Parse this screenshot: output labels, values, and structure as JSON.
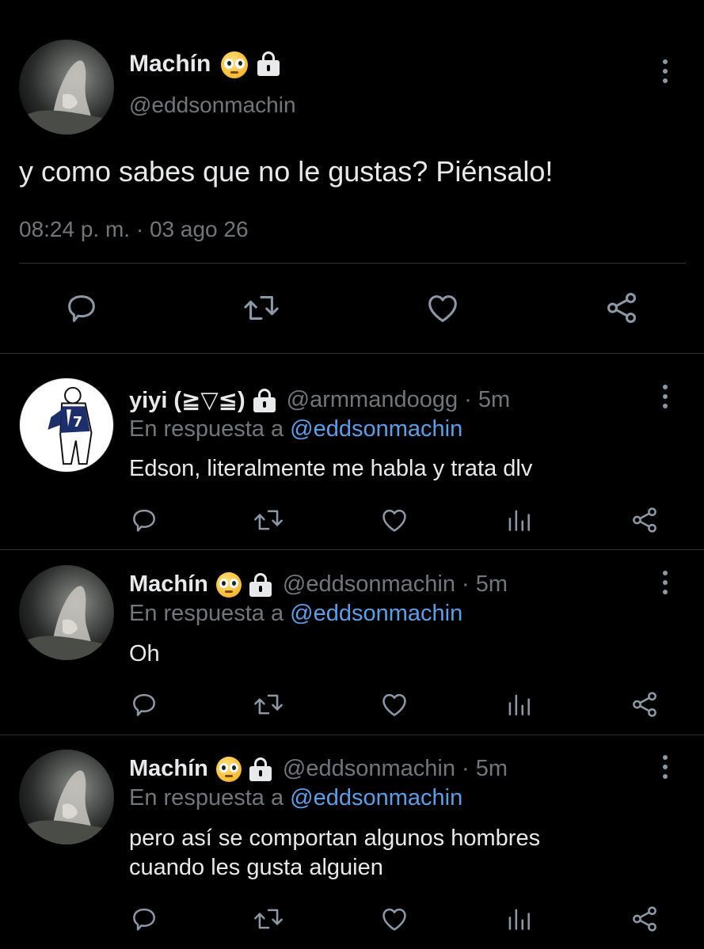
{
  "main_tweet": {
    "display_name": "Machín",
    "handle": "@eddsonmachin",
    "text": "y como sabes que no le gustas? Piénsalo!",
    "timestamp": "08:24 p. m. · 03 ago 26",
    "icons": [
      "flushed-face-emoji",
      "lock-icon",
      "more-options-icon",
      "reply-icon",
      "retweet-icon",
      "like-icon",
      "share-icon"
    ]
  },
  "replies": [
    {
      "display_name": "yiyi (≧▽≦)",
      "handle": "@armmandoogg",
      "time": "· 5m",
      "reply_prefix": "En respuesta a",
      "reply_to": "@eddsonmachin",
      "text_lines": [
        "Edson, literalmente me habla y trata dlv"
      ]
    },
    {
      "display_name": "Machín",
      "handle": "@eddsonmachin",
      "time": "· 5m",
      "reply_prefix": "En respuesta a",
      "reply_to": "@eddsonmachin",
      "text_lines": [
        "Oh"
      ]
    },
    {
      "display_name": "Machín",
      "handle": "@eddsonmachin",
      "time": "· 5m",
      "reply_prefix": "En respuesta a",
      "reply_to": "@eddsonmachin",
      "text_lines": [
        "pero así se comportan algunos hombres",
        "cuando les gusta alguien"
      ]
    }
  ],
  "colors": {
    "background": "#000000",
    "text": "#e7e9ea",
    "muted": "#71767b",
    "link": "#5a9fe8",
    "divider": "#2f3336"
  }
}
